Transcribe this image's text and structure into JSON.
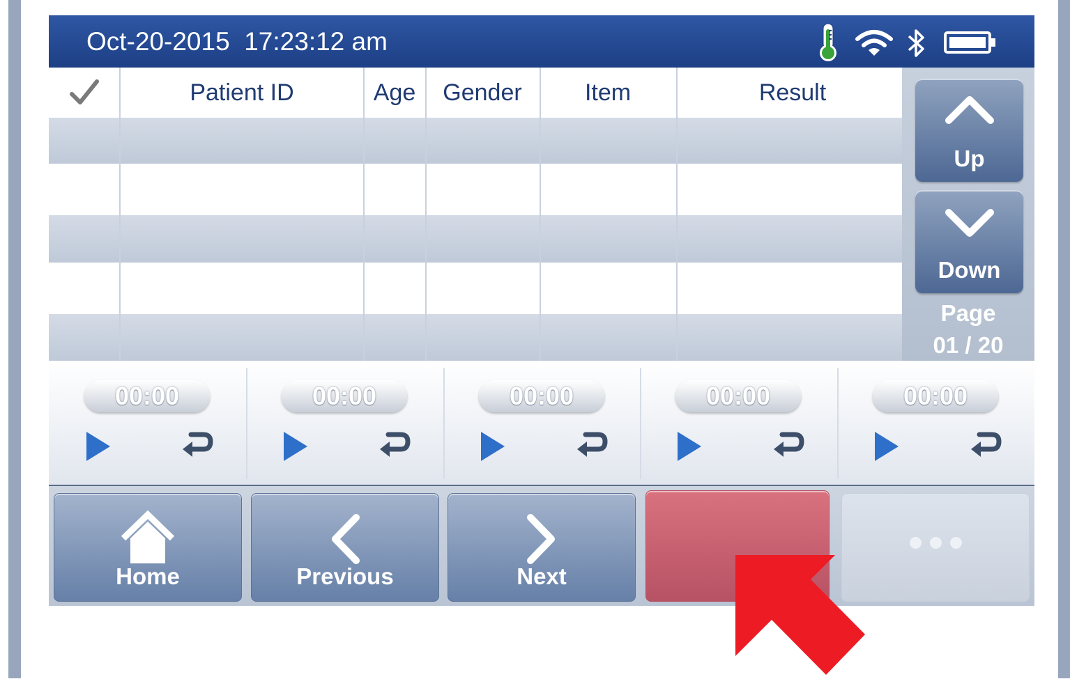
{
  "header": {
    "datetime": "Oct-20-2015  17:23:12 am",
    "status_icons": [
      "thermometer-icon",
      "wifi-icon",
      "bluetooth-icon",
      "battery-icon"
    ],
    "color": "#1f4a97"
  },
  "table": {
    "columns": [
      "",
      "Patient ID",
      "Age",
      "Gender",
      "Item",
      "Result"
    ],
    "rows": [
      [
        "",
        "",
        "",
        "",
        "",
        ""
      ],
      [
        "",
        "",
        "",
        "",
        "",
        ""
      ],
      [
        "",
        "",
        "",
        "",
        "",
        ""
      ],
      [
        "",
        "",
        "",
        "",
        "",
        ""
      ],
      [
        "",
        "",
        "",
        "",
        "",
        ""
      ]
    ]
  },
  "scroll": {
    "up_label": "Up",
    "down_label": "Down",
    "page_label": "Page",
    "page_value": "01 / 20"
  },
  "timers": [
    {
      "time": "00:00"
    },
    {
      "time": "00:00"
    },
    {
      "time": "00:00"
    },
    {
      "time": "00:00"
    },
    {
      "time": "00:00"
    }
  ],
  "bottom_buttons": [
    {
      "label": "Home",
      "icon": "home-icon"
    },
    {
      "label": "Previous",
      "icon": "chevron-left-icon"
    },
    {
      "label": "Next",
      "icon": "chevron-right-icon"
    },
    {
      "label": "",
      "color": "#c9616f"
    },
    {
      "label": "",
      "icon": "more-dots-icon"
    }
  ],
  "annotation": {
    "color": "#ed1c24",
    "icon": "red-arrow-icon"
  }
}
